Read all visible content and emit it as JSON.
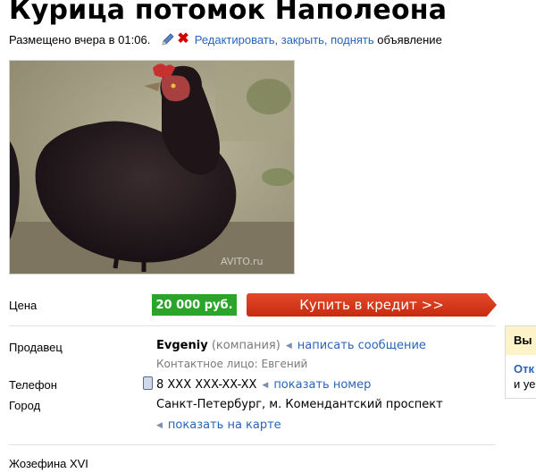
{
  "title": "Курица потомок Наполеона",
  "meta": {
    "posted": "Размещено вчера в 01:06.",
    "actions": "Редактировать, закрыть, поднять",
    "actions_suffix": "объявление"
  },
  "photo": {
    "watermark": "AVITO.ru"
  },
  "price": {
    "label": "Цена",
    "value": "20 000 руб.",
    "credit_button": "Купить в кредит >>"
  },
  "seller": {
    "label": "Продавец",
    "name": "Evgeniy",
    "type": "(компания)",
    "message_link": "написать сообщение",
    "contact": "Контактное лицо: Евгений"
  },
  "phone": {
    "label": "Телефон",
    "value": "8 XXX XXX-XX-XX",
    "show_link": "показать номер"
  },
  "city": {
    "label": "Город",
    "value": "Санкт-Петербург, м. Комендантский проспект",
    "map_link": "показать на карте"
  },
  "side": {
    "head": "Вы",
    "line1": "Отк",
    "line2": "и уе"
  },
  "description": "Жозефина XVI",
  "colors": {
    "price_bg": "#2aa52a",
    "credit_bg": "#d23a1c",
    "link": "#2a63b8"
  }
}
